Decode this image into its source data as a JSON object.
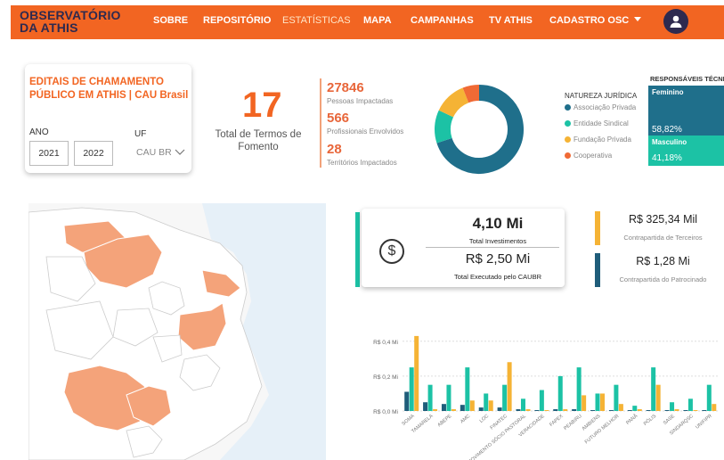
{
  "nav": {
    "logo_line1": "OBSERVATÓRIO",
    "logo_line2": "DA ATHIS",
    "items": [
      {
        "label": "SOBRE"
      },
      {
        "label": "REPOSITÓRIO"
      },
      {
        "label": "ESTATÍSTICAS"
      },
      {
        "label": "MAPA"
      },
      {
        "label": "CAMPANHAS"
      },
      {
        "label": "TV ATHIS"
      },
      {
        "label": "CADASTRO OSC"
      }
    ],
    "active": "ESTATÍSTICAS",
    "user_icon": "user-avatar-icon",
    "brand_color": "#f26522"
  },
  "filter": {
    "title": "EDITAIS DE CHAMAMENTO PÚBLICO EM ATHIS | CAU Brasil",
    "ano_label": "ANO",
    "ano_from": "2021",
    "ano_to": "2022",
    "uf_label": "UF",
    "uf_value": "CAU BR"
  },
  "kpis": {
    "termos_value": "17",
    "termos_label": "Total de Termos de Fomento",
    "pessoas_value": "27846",
    "pessoas_label": "Pessoas Impactadas",
    "profissionais_value": "566",
    "profissionais_label": "Profissionais Envolvidos",
    "territorios_value": "28",
    "territorios_label": "Territórios Impactados"
  },
  "natureza": {
    "title": "NATUREZA JURÍDICA",
    "items": [
      {
        "label": "Associação Privada",
        "color": "#1f6f8b",
        "share": 0.7
      },
      {
        "label": "Entidade Sindical",
        "color": "#1cc2a5",
        "share": 0.12
      },
      {
        "label": "Fundação Privada",
        "color": "#f5b335",
        "share": 0.12
      },
      {
        "label": "Cooperativa",
        "color": "#f06a35",
        "share": 0.06
      }
    ]
  },
  "responsaveis": {
    "title": "RESPONSÁVEIS TÉCNICOS",
    "feminino_label": "Feminino",
    "feminino_value": "58,82%",
    "masculino_label": "Masculino",
    "masculino_value": "41,18%"
  },
  "investimentos": {
    "total_value": "4,10 Mi",
    "total_label": "Total Investimentos",
    "exec_value": "R$ 2,50 Mi",
    "exec_label": "Total Executado pelo CAUBR",
    "terceiros_value": "R$ 325,34 Mil",
    "terceiros_label": "Contrapartida de Terceiros",
    "patrocinado_value": "R$ 1,28 Mi",
    "patrocinado_label": "Contrapartida do Patrocinado"
  },
  "chart_data": {
    "type": "bar",
    "categories": [
      "SOMA",
      "TAMARELA",
      "ABEPE",
      "AMC",
      "LOC",
      "FINATEC",
      "MOVIMENTO SÓCIO PASTORAL",
      "VERACIDADE",
      "FAPEX",
      "PEABIRU",
      "AMBIENS",
      "FUTURO MELHOR",
      "PANÃ",
      "PÓLIS",
      "SASE",
      "SINDARQSC",
      "UNIFIPR"
    ],
    "series": [
      {
        "color": "#1f5d7a",
        "values": [
          0.11,
          0.05,
          0.04,
          0.035,
          0.02,
          0.02,
          0.01,
          0.005,
          0.01,
          0.01,
          0.005,
          0.005,
          0.005,
          0.005,
          0.005,
          0.005,
          0.005
        ]
      },
      {
        "color": "#1cc2a5",
        "values": [
          0.25,
          0.15,
          0.15,
          0.25,
          0.1,
          0.15,
          0.07,
          0.12,
          0.2,
          0.25,
          0.1,
          0.15,
          0.03,
          0.25,
          0.05,
          0.07,
          0.15
        ]
      },
      {
        "color": "#f5b335",
        "values": [
          0.43,
          0.01,
          0.01,
          0.06,
          0.06,
          0.28,
          0.01,
          0.005,
          0.01,
          0.09,
          0.1,
          0.04,
          0.01,
          0.15,
          0.01,
          0.005,
          0.04
        ]
      }
    ],
    "ylim": [
      0,
      0.45
    ],
    "yticks": [
      "R$ 0,0 Mi",
      "R$ 0,2 Mi",
      "R$ 0,4 Mi"
    ],
    "ytick_values": [
      0,
      0.2,
      0.4
    ],
    "grid": true
  }
}
